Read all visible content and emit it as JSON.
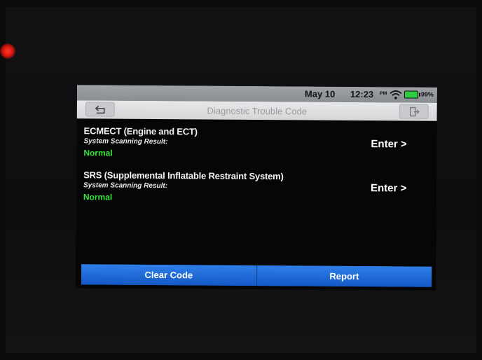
{
  "status": {
    "date": "May 10",
    "time": "12:23",
    "ampm": "PM",
    "battery": "99%",
    "battery_color": "#2ecc40"
  },
  "header": {
    "title": "Diagnostic Trouble Code",
    "back_icon": "back-icon",
    "exit_icon": "exit-icon"
  },
  "systems": [
    {
      "name": "ECMECT (Engine and ECT)",
      "scan_label": "System Scanning Result:",
      "result": "Normal",
      "action": "Enter >"
    },
    {
      "name": "SRS (Supplemental Inflatable Restraint System)",
      "scan_label": "System Scanning Result:",
      "result": "Normal",
      "action": "Enter >"
    }
  ],
  "footer": {
    "clear_label": "Clear Code",
    "report_label": "Report"
  },
  "colors": {
    "accent": "#1664d9",
    "normal": "#37e23a"
  }
}
